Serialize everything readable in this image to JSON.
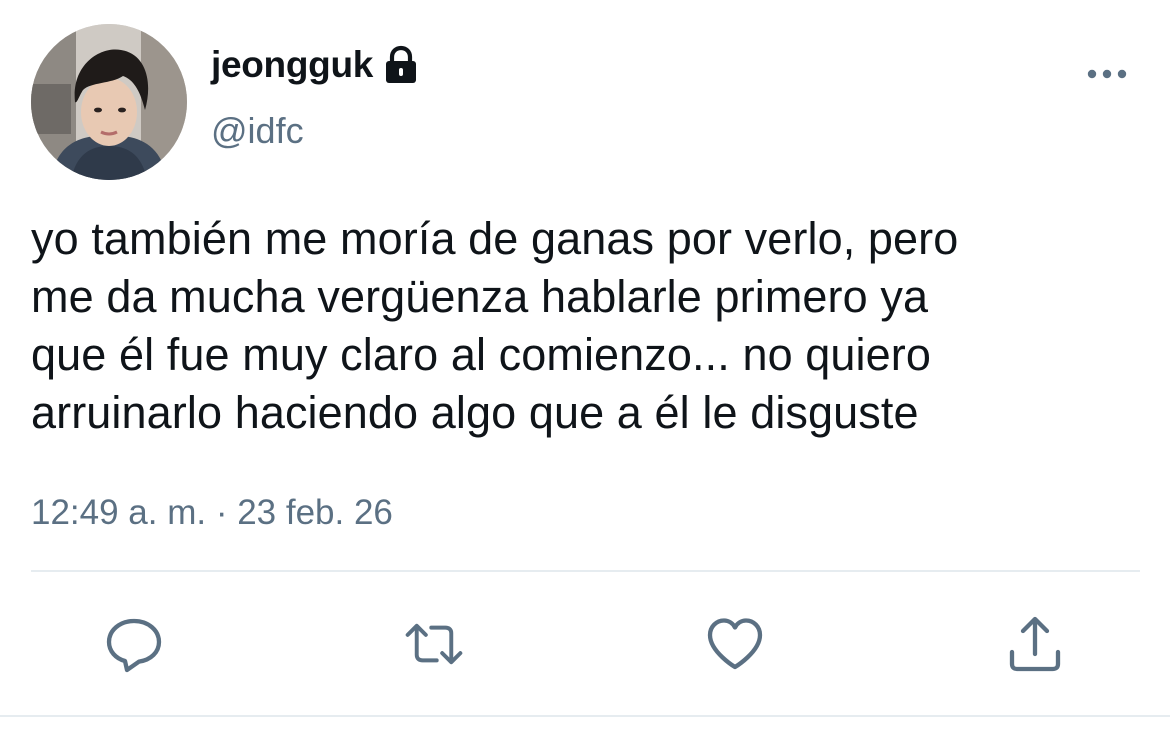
{
  "tweet": {
    "display_name": "jeongguk",
    "handle": "@idfc",
    "protected": true,
    "text": "yo también me moría de ganas por verlo, pero\nme da mucha vergüenza hablarle primero ya\nque él fue muy claro al comienzo... no quiero\narruinarlo haciendo algo que a él le disguste",
    "timestamp": "12:49 a. m. · 23 feb. 26"
  },
  "icons": {
    "lock": "lock-icon",
    "more": "more-options-icon",
    "reply": "reply-icon",
    "retweet": "retweet-icon",
    "like": "heart-icon",
    "share": "share-icon"
  },
  "colors": {
    "text": "#0f1419",
    "secondary": "#5b7083",
    "divider": "#e6ecf0"
  }
}
